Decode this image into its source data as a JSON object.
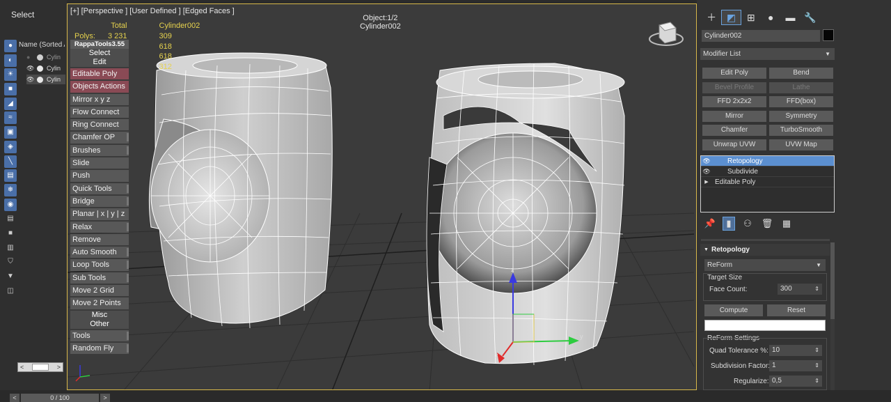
{
  "left_panel": {
    "select_label": "Select",
    "explorer_header": "Name (Sorted A",
    "explorer_rows": [
      "Cylin",
      "Cylin",
      "Cylin"
    ],
    "scroll_left": "<",
    "scroll_right": ">"
  },
  "timeline": {
    "frame": "0 / 100",
    "prev": "<",
    "next": ">"
  },
  "viewport": {
    "label": "[+] [Perspective ] [User Defined ] [Edged Faces ]",
    "object_count": "Object:1/2",
    "object_name": "Cylinder002",
    "stats": {
      "total_header": "Total",
      "name_header": "Cylinder002",
      "polys_label": "Polys:",
      "polys_total": "3 231",
      "values": [
        "309",
        "618",
        "618",
        "312"
      ]
    },
    "rappa": {
      "title": "RappaTools3.55",
      "head_select": "Select",
      "head_edit": "Edit",
      "buttons": [
        "Editable Poly",
        "Objects Actions",
        "Mirror    x  y  z",
        "Flow Connect",
        "Ring Connect",
        "Chamfer OP",
        "Brushes",
        "Slide",
        "Push",
        "Quick Tools",
        "Bridge",
        "Planar | x | y | z",
        "Relax",
        "Remove",
        "Auto Smooth",
        "Loop Tools",
        "Sub Tools",
        "Move 2 Grid",
        "Move 2 Points"
      ],
      "misc": "Misc",
      "other": "Other",
      "tools": "Tools",
      "random_fly": "Random Fly"
    },
    "gizmo": {
      "z": "z",
      "y": "y",
      "x": "x"
    }
  },
  "command_panel": {
    "object_name": "Cylinder002",
    "object_color": "#050505",
    "modifier_list": "Modifier List",
    "modifier_buttons": [
      {
        "label": "Edit Poly",
        "enabled": true
      },
      {
        "label": "Bend",
        "enabled": true
      },
      {
        "label": "Bevel Profile",
        "enabled": false
      },
      {
        "label": "Lathe",
        "enabled": false
      },
      {
        "label": "FFD 2x2x2",
        "enabled": true
      },
      {
        "label": "FFD(box)",
        "enabled": true
      },
      {
        "label": "Mirror",
        "enabled": true
      },
      {
        "label": "Symmetry",
        "enabled": true
      },
      {
        "label": "Chamfer",
        "enabled": true
      },
      {
        "label": "TurboSmooth",
        "enabled": true
      },
      {
        "label": "Unwrap UVW",
        "enabled": true
      },
      {
        "label": "UVW Map",
        "enabled": true
      }
    ],
    "stack": [
      {
        "label": "Retopology",
        "selected": true
      },
      {
        "label": "Subdivide",
        "selected": false
      },
      {
        "label": "Editable Poly",
        "selected": false
      }
    ],
    "rollout": {
      "title": "Retopology",
      "mode": "ReForm",
      "target_size": "Target Size",
      "face_count_label": "Face Count:",
      "face_count": "300",
      "compute": "Compute",
      "reset": "Reset",
      "settings_title": "ReForm Settings",
      "quad_tol_label": "Quad Tolerance %:",
      "quad_tol": "10",
      "subdiv_label": "Subdivision Factor:",
      "subdiv": "1",
      "regularize_label": "Regularize:",
      "regularize": "0,5"
    }
  }
}
